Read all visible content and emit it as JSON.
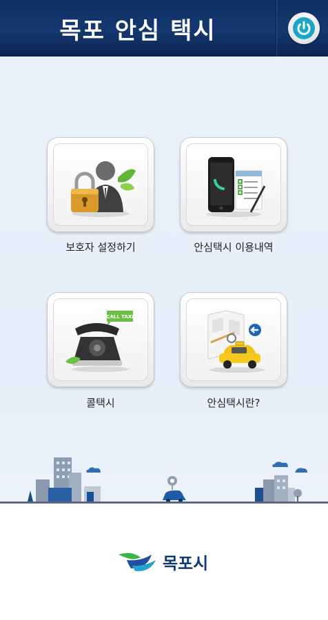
{
  "header": {
    "title": "목포 안심 택시",
    "power_icon": "power-icon"
  },
  "menu": {
    "items": [
      {
        "label": "보호자 설정하기",
        "icon": "guardian-lock-icon"
      },
      {
        "label": "안심택시 이용내역",
        "icon": "phone-history-icon"
      },
      {
        "label": "콜택시",
        "icon": "call-taxi-phone-icon"
      },
      {
        "label": "안심택시란?",
        "icon": "taxi-map-icon"
      }
    ]
  },
  "footer": {
    "logo_text": "목포시"
  },
  "colors": {
    "header": "#14386f",
    "background": "#eaf1fa",
    "accent": "#1aa6c7",
    "logo": "#0f3a7a"
  }
}
